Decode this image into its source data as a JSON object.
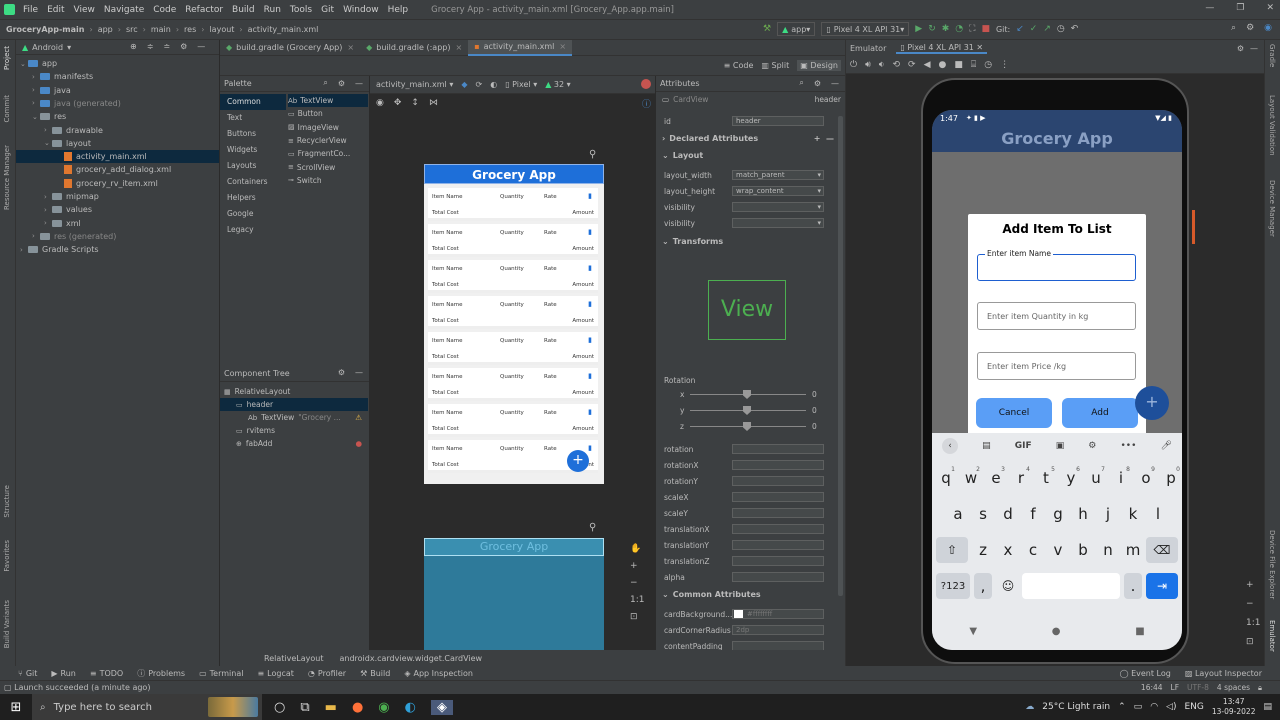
{
  "menu": {
    "items": [
      "File",
      "Edit",
      "View",
      "Navigate",
      "Code",
      "Refactor",
      "Build",
      "Run",
      "Tools",
      "Git",
      "Window",
      "Help"
    ],
    "window_title": "Grocery App - activity_main.xml [Grocery_App.app.main]"
  },
  "navbar": {
    "breadcrumbs": [
      "GroceryApp-main",
      "app",
      "src",
      "main",
      "res",
      "layout",
      "activity_main.xml"
    ],
    "run_config": "app",
    "device": "Pixel 4 XL API 31",
    "git_label": "Git:"
  },
  "left_strip": [
    "Project",
    "Commit",
    "Resource Manager",
    "Structure",
    "Favorites",
    "Build Variants"
  ],
  "right_strip": [
    "Gradle",
    "Layout Validation",
    "Device Manager",
    "Device File Explorer",
    "Emulator"
  ],
  "project": {
    "view_label": "Android",
    "tree": [
      {
        "label": "app",
        "depth": 0,
        "type": "folder-blue",
        "open": true
      },
      {
        "label": "manifests",
        "depth": 1,
        "type": "folder-blue",
        "open": false
      },
      {
        "label": "java",
        "depth": 1,
        "type": "folder-blue",
        "open": false
      },
      {
        "label": "java (generated)",
        "depth": 1,
        "type": "folder-blue",
        "open": false
      },
      {
        "label": "res",
        "depth": 1,
        "type": "folder",
        "open": true
      },
      {
        "label": "drawable",
        "depth": 2,
        "type": "folder",
        "open": false
      },
      {
        "label": "layout",
        "depth": 2,
        "type": "folder",
        "open": true
      },
      {
        "label": "activity_main.xml",
        "depth": 3,
        "type": "xml",
        "selected": true
      },
      {
        "label": "grocery_add_dialog.xml",
        "depth": 3,
        "type": "xml"
      },
      {
        "label": "grocery_rv_item.xml",
        "depth": 3,
        "type": "xml"
      },
      {
        "label": "mipmap",
        "depth": 2,
        "type": "folder",
        "open": false
      },
      {
        "label": "values",
        "depth": 2,
        "type": "folder",
        "open": false
      },
      {
        "label": "xml",
        "depth": 2,
        "type": "folder",
        "open": false
      },
      {
        "label": "res (generated)",
        "depth": 1,
        "type": "folder",
        "open": false
      },
      {
        "label": "Gradle Scripts",
        "depth": 0,
        "type": "folder",
        "open": false
      }
    ]
  },
  "editor_tabs": [
    {
      "label": "build.gradle (Grocery App)",
      "active": false
    },
    {
      "label": "build.gradle (:app)",
      "active": false
    },
    {
      "label": "activity_main.xml",
      "active": true
    }
  ],
  "view_modes": [
    "Code",
    "Split",
    "Design"
  ],
  "palette": {
    "title": "Palette",
    "categories": [
      "Common",
      "Text",
      "Buttons",
      "Widgets",
      "Layouts",
      "Containers",
      "Helpers",
      "Google",
      "Legacy"
    ],
    "widgets": [
      "TextView",
      "Button",
      "ImageView",
      "RecyclerView",
      "FragmentCo...",
      "ScrollView",
      "Switch"
    ]
  },
  "design_toolbar": {
    "file": "activity_main.xml",
    "device": "Pixel",
    "api": "32"
  },
  "component_tree": {
    "title": "Component Tree",
    "items": [
      {
        "label": "RelativeLayout",
        "depth": 0
      },
      {
        "label": "header",
        "depth": 1,
        "selected": true
      },
      {
        "label": "TextView",
        "hint": "\"Grocery ...",
        "depth": 2,
        "warn": true
      },
      {
        "label": "rvitems",
        "depth": 1
      },
      {
        "label": "fabAdd",
        "depth": 1,
        "error": true
      }
    ]
  },
  "preview": {
    "app_title": "Grocery App",
    "row": {
      "name": "Item Name",
      "qty": "Quantity",
      "rate": "Rate",
      "total": "Total Cost",
      "amount": "Amount"
    },
    "row_count": 8,
    "fab": "+"
  },
  "attributes": {
    "title": "Attributes",
    "component": "CardView",
    "component_id": "header",
    "id_label": "id",
    "id_value": "header",
    "sections": {
      "declared": "Declared Attributes",
      "layout": "Layout",
      "transforms": "Transforms",
      "common": "Common Attributes"
    },
    "layout_rows": [
      {
        "label": "layout_width",
        "value": "match_parent"
      },
      {
        "label": "layout_height",
        "value": "wrap_content"
      },
      {
        "label": "visibility",
        "value": ""
      },
      {
        "label": "visibility",
        "value": ""
      }
    ],
    "view_label": "View",
    "rotation_label": "Rotation",
    "sliders": [
      {
        "axis": "x",
        "value": "0"
      },
      {
        "axis": "y",
        "value": "0"
      },
      {
        "axis": "z",
        "value": "0"
      }
    ],
    "transform_rows": [
      "rotation",
      "rotationX",
      "rotationY",
      "scaleX",
      "scaleY",
      "translationX",
      "translationY",
      "translationZ",
      "alpha"
    ],
    "common_rows": [
      {
        "label": "cardBackground...",
        "value": "#ffffffff"
      },
      {
        "label": "cardCornerRadius",
        "value": "2dp"
      },
      {
        "label": "contentPadding",
        "value": ""
      }
    ]
  },
  "breadcrumb_bottom": [
    "RelativeLayout",
    "androidx.cardview.widget.CardView"
  ],
  "emulator": {
    "tab_label": "Emulator",
    "device_tab": "Pixel 4 XL API 31",
    "phone": {
      "time": "1:47",
      "app_title": "Grocery App",
      "dialog": {
        "title": "Add Item To List",
        "name_label": "Enter item Name",
        "qty_placeholder": "Enter item Quantity in kg",
        "price_placeholder": "Enter item Price /kg",
        "cancel": "Cancel",
        "add": "Add"
      },
      "fab": "+",
      "keyboard": {
        "row1": [
          "q",
          "w",
          "e",
          "r",
          "t",
          "y",
          "u",
          "i",
          "o",
          "p"
        ],
        "row1_nums": [
          "1",
          "2",
          "3",
          "4",
          "5",
          "6",
          "7",
          "8",
          "9",
          "0"
        ],
        "row2": [
          "a",
          "s",
          "d",
          "f",
          "g",
          "h",
          "j",
          "k",
          "l"
        ],
        "row3": [
          "z",
          "x",
          "c",
          "v",
          "b",
          "n",
          "m"
        ],
        "sym": "?123",
        "comma": ",",
        "period": ".",
        "gif": "GIF"
      }
    }
  },
  "tool_windows": [
    "Git",
    "Run",
    "TODO",
    "Problems",
    "Terminal",
    "Logcat",
    "Profiler",
    "Build",
    "App Inspection"
  ],
  "tool_windows_right": [
    "Event Log",
    "Layout Inspector"
  ],
  "status": {
    "message": "Launch succeeded (a minute ago)",
    "position": "16:44",
    "line_sep": "LF",
    "encoding": "UTF-8",
    "indent": "4 spaces"
  },
  "taskbar": {
    "search_placeholder": "Type here to search",
    "weather": "25°C Light rain",
    "lang": "ENG",
    "time": "13:47",
    "date": "13-09-2022"
  },
  "colors": {
    "accent": "#4a88c7",
    "app_header": "#1f4fa0",
    "phone_fab": "#1e6fd9",
    "dialog_btn": "#5a9ef6"
  }
}
